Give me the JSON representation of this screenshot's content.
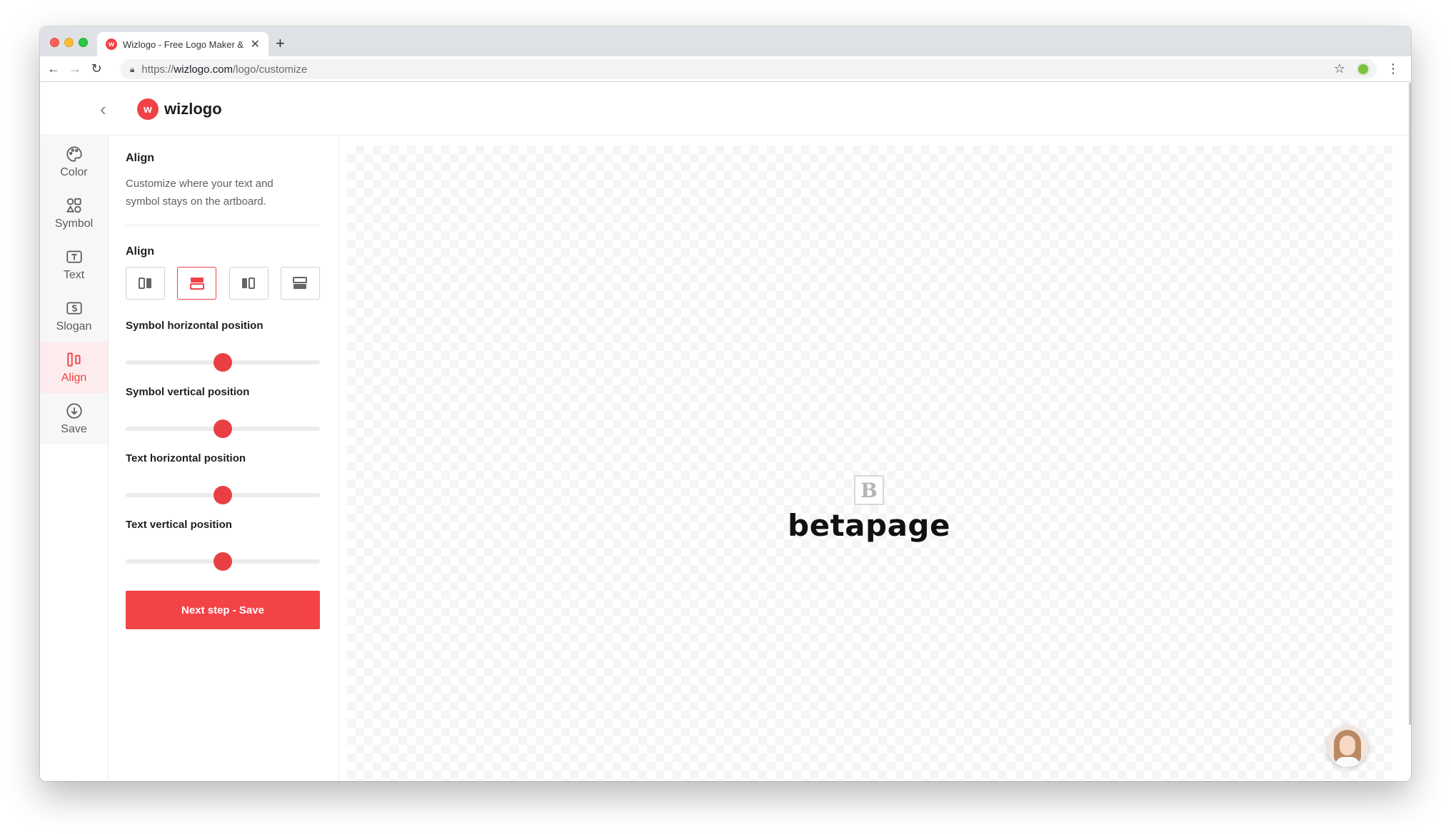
{
  "browser": {
    "tab_title": "Wizlogo - Free Logo Maker & Y",
    "url_scheme": "https://",
    "url_host": "wizlogo.com",
    "url_path": "/logo/customize"
  },
  "app": {
    "logo_text": "wizlogo",
    "brand_color": "#f04246"
  },
  "rail": {
    "items": [
      {
        "label": "Color",
        "icon": "palette-icon"
      },
      {
        "label": "Symbol",
        "icon": "shapes-icon"
      },
      {
        "label": "Text",
        "icon": "text-icon"
      },
      {
        "label": "Slogan",
        "icon": "slogan-icon"
      },
      {
        "label": "Align",
        "icon": "align-icon",
        "active": true
      },
      {
        "label": "Save",
        "icon": "download-icon"
      }
    ]
  },
  "panel": {
    "title": "Align",
    "description": "Customize where your text and symbol stays on the artboard.",
    "align_label": "Align",
    "align_options": [
      "align-left",
      "align-top",
      "align-right",
      "align-bottom"
    ],
    "align_selected": "align-top",
    "sliders": [
      {
        "label": "Symbol horizontal position",
        "value": 0.5
      },
      {
        "label": "Symbol vertical position",
        "value": 0.5
      },
      {
        "label": "Text horizontal position",
        "value": 0.5
      },
      {
        "label": "Text vertical position",
        "value": 0.5
      }
    ],
    "cta_label": "Next step - Save"
  },
  "canvas": {
    "symbol_letter": "B",
    "brand_name": "betapage"
  }
}
